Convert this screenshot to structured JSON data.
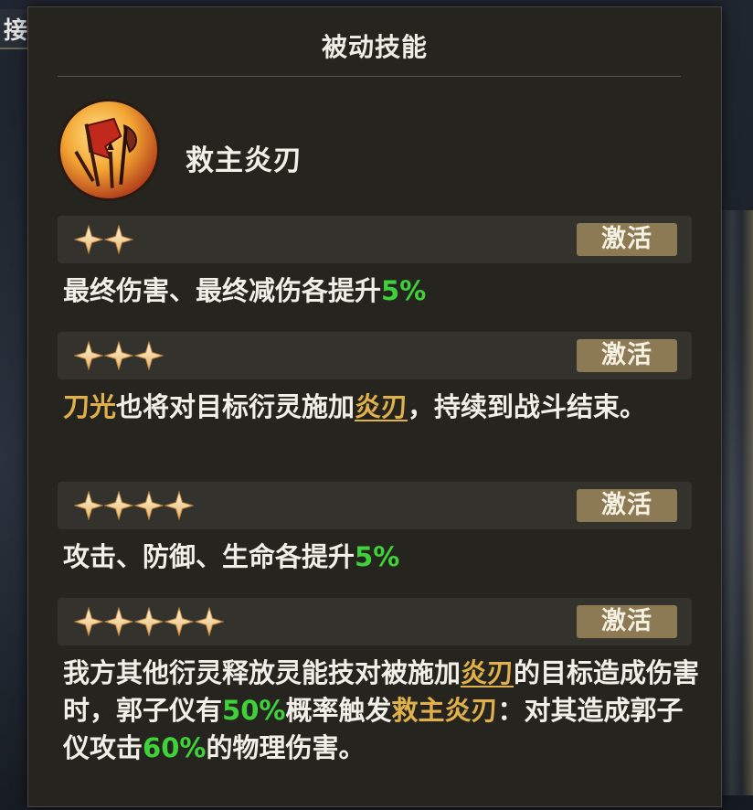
{
  "background": {
    "tab_label": "接"
  },
  "panel": {
    "title": "被动技能",
    "skill": {
      "name": "救主炎刃",
      "icon": "flag-and-blades-icon"
    },
    "colors": {
      "highlight_green": "#3fd13a",
      "highlight_gold": "#e0b14a",
      "button_bg": "#8c7a55"
    },
    "tiers": [
      {
        "stars": 2,
        "button_label": "激活",
        "desc": {
          "t1": "最终伤害、最终减伤各提升",
          "v1": "5%"
        }
      },
      {
        "stars": 3,
        "button_label": "激活",
        "desc": {
          "k1": "刀光",
          "t1": "也将对目标衍灵施加",
          "k2": "炎刃",
          "t2": "，持续到战斗结束。"
        }
      },
      {
        "stars": 4,
        "button_label": "激活",
        "desc": {
          "t1": "攻击、防御、生命各提升",
          "v1": "5%"
        }
      },
      {
        "stars": 5,
        "button_label": "激活",
        "desc": {
          "t1": "我方其他衍灵释放灵能技对被施加",
          "k1": "炎刃",
          "t2": "的目标造成伤害时，郭子仪有",
          "v1": "50%",
          "t3": "概率触发",
          "k2": "救主炎刃",
          "t4": "：对其造成郭子仪攻击",
          "v2": "60%",
          "t5": "的物理伤害。"
        }
      }
    ]
  }
}
